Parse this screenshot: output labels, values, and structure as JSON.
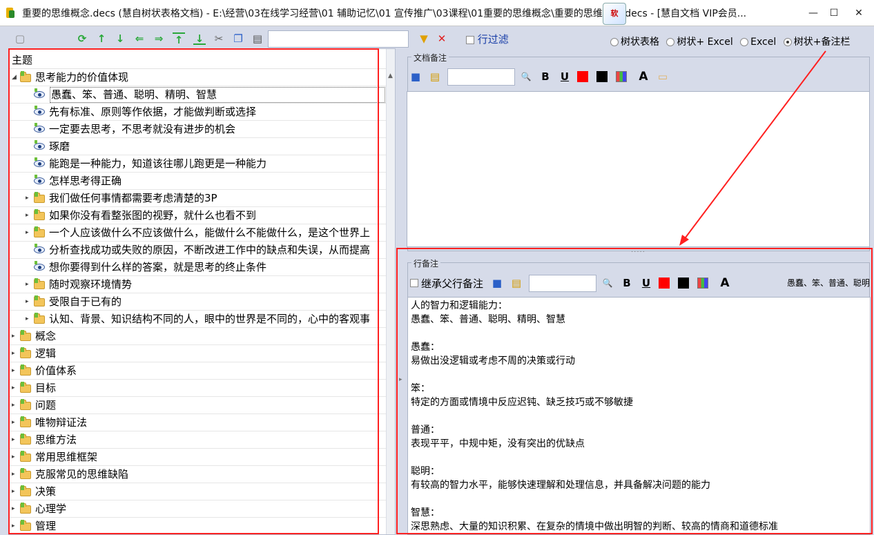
{
  "window": {
    "title": "重要的思维概念.decs (慧自树状表格文档) -  E:\\经营\\03在线学习经营\\01 辅助记忆\\01 宣传推广\\03课程\\01重要的思维概念\\重要的思维概念.decs - [慧自文档 VIP会员...",
    "logo_text": "软",
    "min": "—",
    "max": "☐",
    "close": "✕"
  },
  "toolbar": {
    "filter_placeholder": "",
    "row_filter_label": "行过滤"
  },
  "view_modes": [
    {
      "label": "树状表格",
      "selected": false
    },
    {
      "label": "树状+ Excel",
      "selected": false
    },
    {
      "label": "Excel",
      "selected": false
    },
    {
      "label": "树状+备注栏",
      "selected": true
    }
  ],
  "tree": {
    "header": "主题",
    "rows": [
      {
        "text": "思考能力的价值体现",
        "type": "folder",
        "level": 0,
        "expanded": true
      },
      {
        "text": "愚蠢、笨、普通、聪明、精明、智慧",
        "type": "note",
        "level": 1,
        "selected": true
      },
      {
        "text": "先有标准、原则等作依据，才能做判断或选择",
        "type": "note",
        "level": 1
      },
      {
        "text": "一定要去思考，不思考就没有进步的机会",
        "type": "note",
        "level": 1
      },
      {
        "text": "琢磨",
        "type": "note",
        "level": 1
      },
      {
        "text": "能跑是一种能力，知道该往哪儿跑更是一种能力",
        "type": "note",
        "level": 1
      },
      {
        "text": "怎样思考得正确",
        "type": "note",
        "level": 1
      },
      {
        "text": "我们做任何事情都需要考虑清楚的3P",
        "type": "folder",
        "level": 1
      },
      {
        "text": "如果你没有看整张图的视野，就什么也看不到",
        "type": "folder",
        "level": 1
      },
      {
        "text": "一个人应该做什么不应该做什么，能做什么不能做什么，是这个世界上",
        "type": "folder",
        "level": 1
      },
      {
        "text": "分析查找成功或失败的原因，不断改进工作中的缺点和失误，从而提高",
        "type": "note",
        "level": 1
      },
      {
        "text": "想你要得到什么样的答案，就是思考的终止条件",
        "type": "note",
        "level": 1
      },
      {
        "text": "随时观察环境情势",
        "type": "folder",
        "level": 1
      },
      {
        "text": "受限自于已有的",
        "type": "folder",
        "level": 1
      },
      {
        "text": "认知、背景、知识结构不同的人，眼中的世界是不同的，心中的客观事",
        "type": "folder",
        "level": 1
      },
      {
        "text": "概念",
        "type": "folder",
        "level": 0
      },
      {
        "text": "逻辑",
        "type": "folder",
        "level": 0
      },
      {
        "text": "价值体系",
        "type": "folder",
        "level": 0
      },
      {
        "text": "目标",
        "type": "folder",
        "level": 0
      },
      {
        "text": "问题",
        "type": "folder",
        "level": 0
      },
      {
        "text": "唯物辩证法",
        "type": "folder",
        "level": 0
      },
      {
        "text": "思维方法",
        "type": "folder",
        "level": 0
      },
      {
        "text": "常用思维框架",
        "type": "folder",
        "level": 0
      },
      {
        "text": "克服常见的思维缺陷",
        "type": "folder",
        "level": 0
      },
      {
        "text": "决策",
        "type": "folder",
        "level": 0
      },
      {
        "text": "心理学",
        "type": "folder",
        "level": 0
      },
      {
        "text": "管理",
        "type": "folder",
        "level": 0
      }
    ]
  },
  "doc_note": {
    "group_label": "文档备注",
    "bold": "B",
    "underline": "U",
    "font_letter": "A",
    "colors": {
      "red": "#ff0000",
      "black": "#000000"
    }
  },
  "row_note": {
    "group_label": "行备注",
    "inherit_label": "继承父行备注",
    "bold": "B",
    "underline": "U",
    "font_letter": "A",
    "current_row": "愚蠢、笨、普通、聪明",
    "content": "人的智力和逻辑能力：\n愚蠢、笨、普通、聪明、精明、智慧\n\n愚蠢：\n易做出没逻辑或考虑不周的决策或行动\n\n笨：\n特定的方面或情境中反应迟钝、缺乏技巧或不够敏捷\n\n普通：\n表现平平，中规中矩，没有突出的优缺点\n\n聪明：\n有较高的智力水平，能够快速理解和处理信息，并具备解决问题的能力\n\n智慧：\n深思熟虑、大量的知识积累、在复杂的情境中做出明智的判断、较高的情商和道德标准"
  }
}
